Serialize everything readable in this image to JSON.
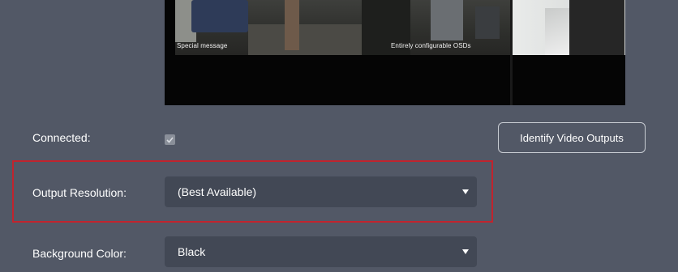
{
  "preview": {
    "osd_left": "Special message",
    "osd_right": "Entirely configurable OSDs"
  },
  "connected": {
    "label": "Connected:",
    "checked": true
  },
  "identify_button": {
    "label": "Identify Video Outputs"
  },
  "output_resolution": {
    "label": "Output Resolution:",
    "value": "(Best Available)"
  },
  "background_color": {
    "label": "Background Color:",
    "value": "Black"
  },
  "colors": {
    "page_background": "#525866",
    "select_background": "#424855",
    "highlight_border": "#c0242e",
    "checkbox_fill": "#8a8f99"
  },
  "icons": {
    "checkbox": "check-icon",
    "dropdown": "caret-down-icon"
  }
}
